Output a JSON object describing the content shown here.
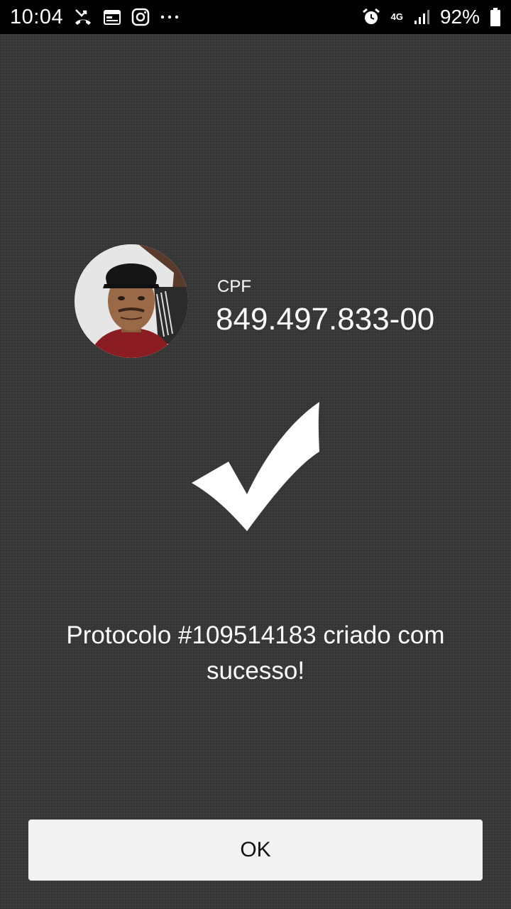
{
  "status_bar": {
    "time": "10:04",
    "network_type": "4G",
    "battery_percent": "92%",
    "left_icons": [
      "missed-call-icon",
      "calendar-icon",
      "instagram-icon",
      "more-dots-icon"
    ],
    "right_icons": [
      "alarm-icon",
      "network-4g-icon",
      "signal-icon",
      "battery-icon"
    ]
  },
  "profile": {
    "cpf_label": "CPF",
    "cpf_value": "849.497.833-00"
  },
  "result": {
    "icon": "checkmark-icon",
    "message": "Protocolo #109514183 criado com sucesso!"
  },
  "actions": {
    "ok_label": "OK"
  },
  "colors": {
    "background": "#3b3b3b",
    "status_bar": "#000000",
    "button_bg": "#f2f2f2",
    "text": "#ffffff"
  }
}
